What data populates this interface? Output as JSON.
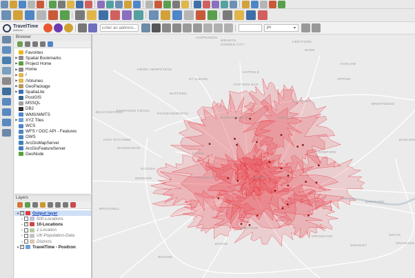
{
  "app": {
    "toolbar_main_icons": [
      "new-project",
      "open-project",
      "save-project",
      "save-as",
      "print-layout",
      "pan",
      "pan-to-selection",
      "zoom-in",
      "zoom-out",
      "zoom-full",
      "zoom-selection",
      "zoom-layer",
      "zoom-native",
      "zoom-last",
      "zoom-next",
      "new-bookmark",
      "show-bookmarks",
      "refresh",
      "identify",
      "select",
      "deselect",
      "open-attribute-table",
      "field-calculator",
      "statistics",
      "toolbox",
      "measure",
      "annotation",
      "tips",
      "python",
      "plugin"
    ],
    "toolbar_digitize_icons": [
      "data-source-manager",
      "new-layer",
      "new-virtual-layer",
      "layer-style",
      "toggle-editing",
      "save-edits",
      "digitize",
      "add-feature",
      "vertex-tool",
      "delete-selected",
      "cut",
      "copy",
      "paste",
      "undo",
      "redo",
      "labels",
      "label-pin",
      "label-show",
      "label-move",
      "label-rotate",
      "label-change",
      "diagram"
    ]
  },
  "traveltime_toolbar": {
    "logo_title": "TravelTime",
    "logo_subtitle": "platform",
    "address_placeholder": "Enter an address...",
    "spin_value": "",
    "unit_value": "px"
  },
  "browser": {
    "title": "Browser",
    "items": [
      {
        "label": "Favorites",
        "icon": "star-icon",
        "color": "#e8b820",
        "expand": false
      },
      {
        "label": "Spatial Bookmarks",
        "icon": "bookmark-icon",
        "color": "#8a8a8a",
        "expand": true
      },
      {
        "label": "Project Home",
        "icon": "project-home-icon",
        "color": "#5aa03c",
        "expand": true
      },
      {
        "label": "Home",
        "icon": "home-folder-icon",
        "color": "#8a8a8a",
        "expand": true
      },
      {
        "label": "/",
        "icon": "folder-icon",
        "color": "#e2b750",
        "expand": true
      },
      {
        "label": "/Volumes",
        "icon": "folder-icon",
        "color": "#e2b750",
        "expand": true
      },
      {
        "label": "GeoPackage",
        "icon": "geopackage-icon",
        "color": "#b79a5a",
        "expand": true
      },
      {
        "label": "SpatiaLite",
        "icon": "spatialite-icon",
        "color": "#3b6fb6",
        "expand": true
      },
      {
        "label": "PostGIS",
        "icon": "postgis-icon",
        "color": "#33668c",
        "expand": false
      },
      {
        "label": "MSSQL",
        "icon": "mssql-icon",
        "color": "#a0a0a0",
        "expand": false
      },
      {
        "label": "DB2",
        "icon": "db2-icon",
        "color": "#333333",
        "expand": false
      },
      {
        "label": "WMS/WMTS",
        "icon": "wms-icon",
        "color": "#4f86c6",
        "expand": false
      },
      {
        "label": "XYZ Tiles",
        "icon": "xyz-tiles-icon",
        "color": "#6aa0d8",
        "expand": true
      },
      {
        "label": "WCS",
        "icon": "wcs-icon",
        "color": "#4f86c6",
        "expand": false
      },
      {
        "label": "WFS / OGC API - Features",
        "icon": "wfs-icon",
        "color": "#4f86c6",
        "expand": false
      },
      {
        "label": "OWS",
        "icon": "ows-icon",
        "color": "#4f86c6",
        "expand": false
      },
      {
        "label": "ArcGisMapServer",
        "icon": "arcgis-map-icon",
        "color": "#3f7fbf",
        "expand": false
      },
      {
        "label": "ArcGisFeatureServer",
        "icon": "arcgis-feature-icon",
        "color": "#3f7fbf",
        "expand": false
      },
      {
        "label": "GeoNode",
        "icon": "geonode-icon",
        "color": "#5aa03c",
        "expand": false
      }
    ]
  },
  "layers": {
    "title": "Layers",
    "items": [
      {
        "label": "Output layer",
        "checked": true,
        "style": "selected",
        "indent": 0,
        "icon": "polygon-layer-icon",
        "color": "#e23b3b"
      },
      {
        "label": "500-Locations",
        "checked": false,
        "style": "italic",
        "indent": 1,
        "icon": "point-layer-icon",
        "color": "#7f7fbf"
      },
      {
        "label": "10-Locations",
        "checked": true,
        "style": "bold",
        "indent": 1,
        "icon": "point-layer-icon",
        "color": "#d04444"
      },
      {
        "label": "1-Location",
        "checked": false,
        "style": "italic",
        "indent": 1,
        "icon": "point-layer-icon",
        "color": "#6b8f4f"
      },
      {
        "label": "UK-Population-Data",
        "checked": false,
        "style": "italic",
        "indent": 1,
        "icon": "table-layer-icon",
        "color": "#888888"
      },
      {
        "label": "Districts",
        "checked": false,
        "style": "italic",
        "indent": 1,
        "icon": "polygon-layer-icon",
        "color": "#b48f6a"
      },
      {
        "label": "TravelTime - Positron",
        "checked": true,
        "style": "bold",
        "indent": 0,
        "icon": "xyz-tiles-icon",
        "color": "#6aa0d8"
      }
    ]
  },
  "map": {
    "basemap_color": "#ebebeb",
    "isochrone_color": "#e8323c",
    "places": [
      "HARPENDEN",
      "WELWYN",
      "GARDEN CITY",
      "HERTFORD",
      "WARE",
      "HEMEL HEMPSTEAD",
      "HATFIELD",
      "ST ALBANS",
      "POTTERS BAR",
      "WATFORD",
      "CHESHUNT",
      "BRENTWOOD",
      "RICKMANSWORTH",
      "BOREHAM WOOD",
      "ENFIELD",
      "HIGH WYCOMBE",
      "HAYES",
      "ROMFORD",
      "SLOUGH",
      "HOUNSLOW",
      "LONDON",
      "CROYDON",
      "EPSOM",
      "GRAYS",
      "GRAVESEND",
      "SWANLEY",
      "BRACKNELL",
      "BEACONSFIELD",
      "GERRARDS CROSS",
      "WINDSOR",
      "MAIDENHEAD",
      "DARTFORD",
      "ORPINGTON",
      "HARLOW",
      "EPPING",
      "BASILDON",
      "WOKING"
    ]
  }
}
